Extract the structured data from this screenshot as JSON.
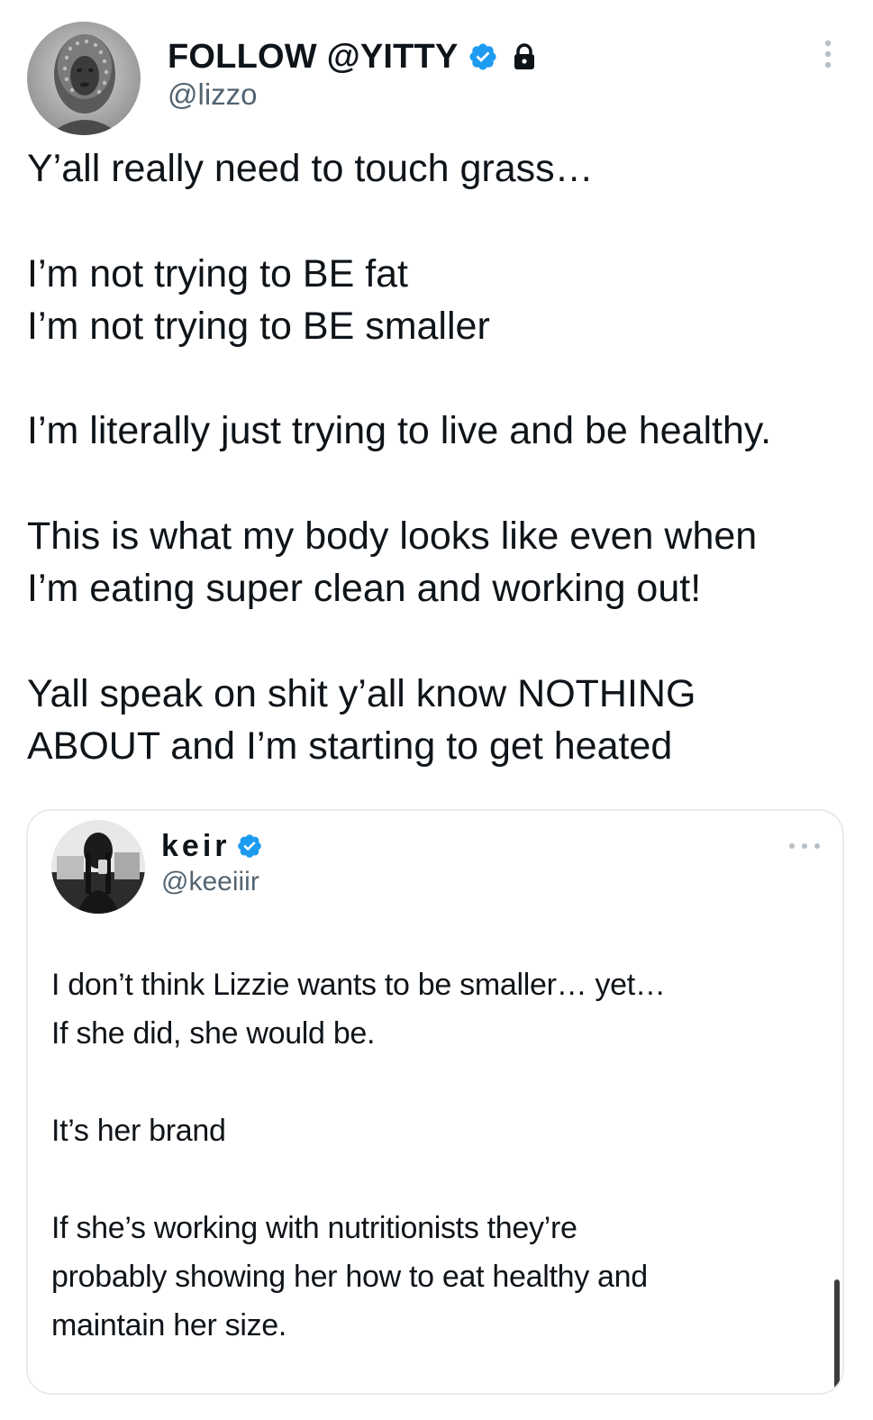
{
  "author": {
    "display_name": "FOLLOW @YITTY",
    "handle": "@lizzo",
    "verified": true,
    "protected_icon": "lock-icon",
    "accent_color": "#1d9bf0"
  },
  "tweet": {
    "lines": [
      "Y’all really need to touch grass…",
      "I’m not trying to BE fat",
      "I’m not trying to BE smaller",
      "I’m literally just trying to live and be healthy.",
      "This is what my body looks like even when",
      "I’m eating super clean and working out!",
      "Yall speak on shit y’all know NOTHING",
      "ABOUT and I’m starting to get heated"
    ]
  },
  "quoted_tweet": {
    "display_name": "keir",
    "handle": "@keeiiir",
    "verified": true,
    "lines": [
      "I don’t think Lizzie wants to be smaller…  yet…",
      "If she did, she would be.",
      "It’s her brand",
      "If she’s working with nutritionists they’re",
      "probably showing her how to eat healthy and",
      "maintain her size."
    ]
  },
  "icons": {
    "menu": "more-vertical-icon",
    "quote_menu": "more-horizontal-icon",
    "verified": "verified-badge-icon"
  }
}
